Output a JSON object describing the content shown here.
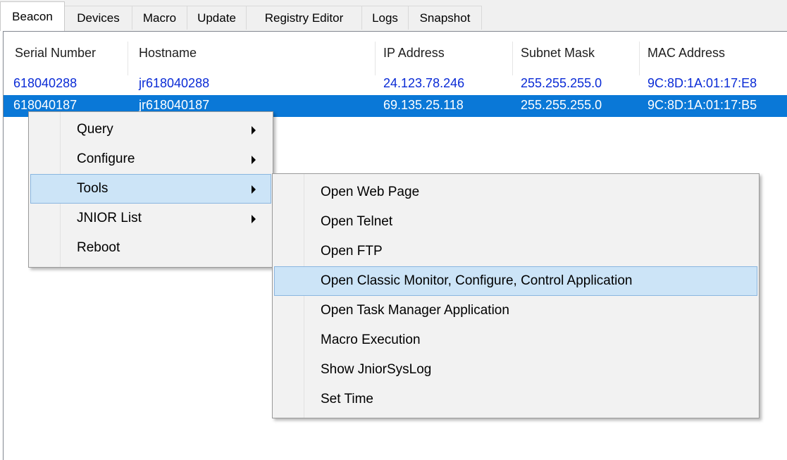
{
  "tabs": [
    "Beacon",
    "Devices",
    "Macro",
    "Update",
    "Registry Editor",
    "Logs",
    "Snapshot"
  ],
  "columns": [
    "Serial Number",
    "Hostname",
    "IP Address",
    "Subnet Mask",
    "MAC Address"
  ],
  "rows": [
    {
      "serial": "618040288",
      "hostname": "jr618040288",
      "ip": "24.123.78.246",
      "subnet": "255.255.255.0",
      "mac": "9C:8D:1A:01:17:E8",
      "selected": false
    },
    {
      "serial": "618040187",
      "hostname": "jr618040187",
      "ip": "69.135.25.118",
      "subnet": "255.255.255.0",
      "mac": "9C:8D:1A:01:17:B5",
      "selected": true
    }
  ],
  "context_menu": {
    "items": [
      {
        "label": "Query",
        "has_submenu": true
      },
      {
        "label": "Configure",
        "has_submenu": true
      },
      {
        "label": "Tools",
        "has_submenu": true,
        "highlighted": true
      },
      {
        "label": "JNIOR List",
        "has_submenu": true
      },
      {
        "label": "Reboot",
        "has_submenu": false
      }
    ]
  },
  "tools_submenu": {
    "items": [
      {
        "label": "Open Web Page"
      },
      {
        "label": "Open Telnet"
      },
      {
        "label": "Open FTP"
      },
      {
        "label": "Open Classic Monitor, Configure, Control Application",
        "highlighted": true
      },
      {
        "label": "Open Task Manager Application"
      },
      {
        "label": "Macro Execution"
      },
      {
        "label": "Show JniorSysLog"
      },
      {
        "label": "Set Time"
      }
    ]
  },
  "colors": {
    "selection": "#0a78d7",
    "link_text": "#0a2bd6",
    "menu_highlight": "#cce4f7"
  }
}
